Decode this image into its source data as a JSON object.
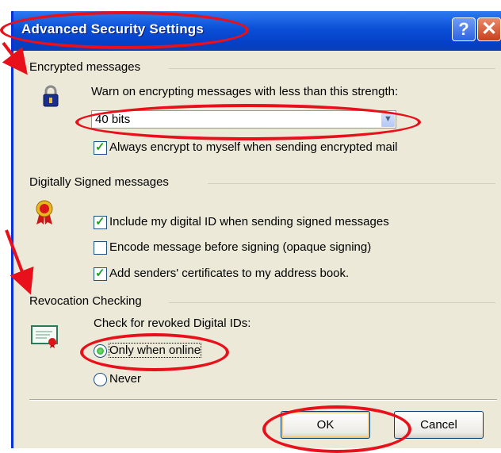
{
  "window": {
    "title": "Advanced Security Settings",
    "help_glyph": "?",
    "close_glyph": "✕"
  },
  "encrypted": {
    "heading": "Encrypted messages",
    "warn_label": "Warn on encrypting messages with less than this strength:",
    "strength_value": "40 bits",
    "always_encrypt_label": "Always encrypt to myself when sending encrypted mail",
    "always_encrypt_checked": true
  },
  "signed": {
    "heading": "Digitally Signed messages",
    "include_id_label": "Include my digital ID when sending signed messages",
    "include_id_checked": true,
    "encode_label": "Encode message before signing (opaque signing)",
    "encode_checked": false,
    "add_certs_label": "Add senders' certificates to my address book.",
    "add_certs_checked": true
  },
  "revocation": {
    "heading": "Revocation Checking",
    "check_label": "Check for revoked Digital IDs:",
    "only_online_label": "Only when online",
    "never_label": "Never",
    "selected": "only_online"
  },
  "buttons": {
    "ok_label": "OK",
    "cancel_label": "Cancel"
  },
  "colors": {
    "title_bar": "#0A4FD6",
    "dialog_bg": "#ECE9D8",
    "annotation": "#E8101A",
    "check_green": "#21A121"
  }
}
